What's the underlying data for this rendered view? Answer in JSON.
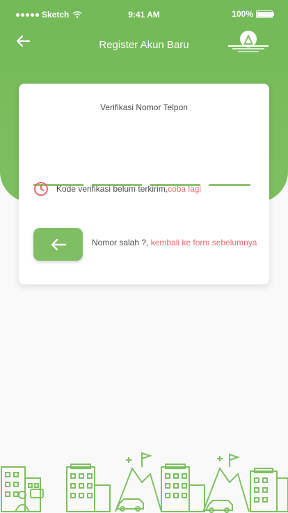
{
  "status_bar": {
    "carrier": "Sketch",
    "time": "9:41 AM",
    "battery": "100%",
    "battery_level": 1.0
  },
  "header": {
    "title": "Register Akun Baru",
    "back_icon": "arrow-left-icon",
    "logo_icon": "mountain-logo-icon"
  },
  "verification": {
    "title": "Verifikasi Nomor Telpon",
    "otp_digits": [
      "",
      "",
      "",
      ""
    ],
    "timer_text": "Kode verifikasi belum terkirim, ",
    "retry_link": "coba lagi",
    "wrong_text": "Nomor salah ?, ",
    "back_link": "kembali ke form sebelumnya",
    "back_button_icon": "arrow-left-icon"
  },
  "colors": {
    "primary": "#7ec061",
    "accent_link": "#e8696b",
    "background": "#f9f9f9"
  }
}
